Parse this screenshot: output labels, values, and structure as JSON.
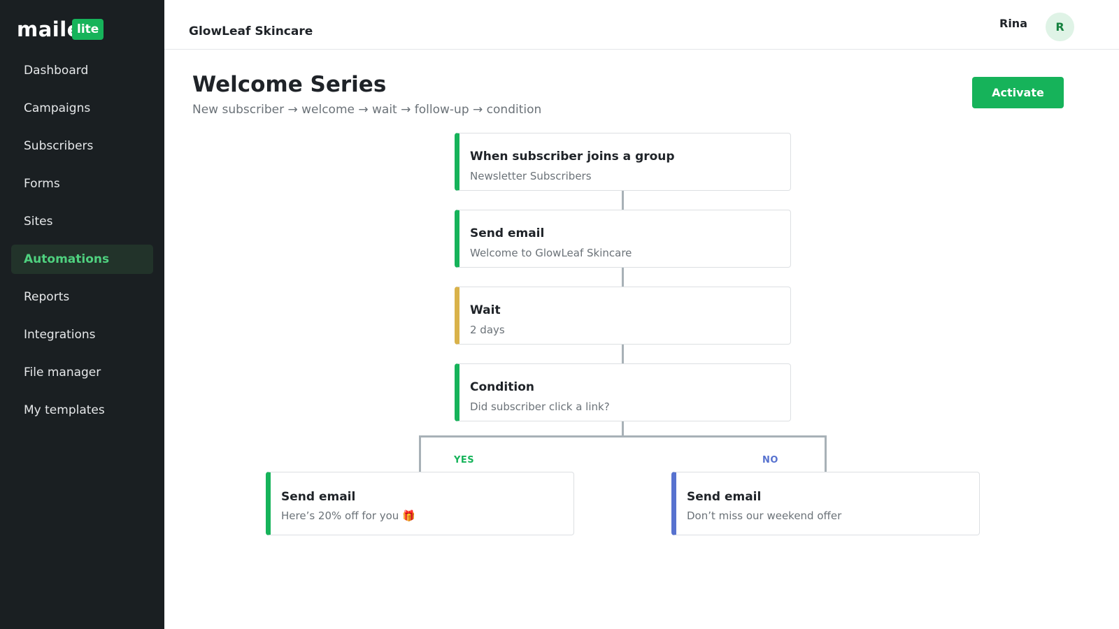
{
  "sidebar": {
    "logo_word": "maile",
    "logo_badge": "lite",
    "items": [
      {
        "label": "Dashboard"
      },
      {
        "label": "Campaigns"
      },
      {
        "label": "Subscribers"
      },
      {
        "label": "Forms"
      },
      {
        "label": "Sites"
      },
      {
        "label": "Automations",
        "active": true
      },
      {
        "label": "Reports"
      },
      {
        "label": "Integrations"
      },
      {
        "label": "File manager"
      },
      {
        "label": "My templates"
      }
    ]
  },
  "header": {
    "brand": "GlowLeaf Skincare",
    "user_name": "Rina",
    "avatar_initial": "R"
  },
  "page": {
    "title": "Welcome Series",
    "subtitle": "New subscriber → welcome → wait → follow-up → condition",
    "activate_label": "Activate"
  },
  "flow": {
    "steps": [
      {
        "title": "When subscriber joins a group",
        "desc": "Newsletter Subscribers",
        "kind": "trigger"
      },
      {
        "title": "Send email",
        "desc": "Welcome to GlowLeaf Skincare",
        "kind": "email"
      },
      {
        "title": "Wait",
        "desc": "2 days",
        "kind": "wait"
      },
      {
        "title": "Condition",
        "desc": "Did subscriber click a link?",
        "kind": "condition"
      }
    ],
    "branches": {
      "yes": {
        "label": "YES",
        "title": "Send email",
        "desc": "Here’s 20% off for you 🎁"
      },
      "no": {
        "label": "NO",
        "title": "Send email",
        "desc": "Don’t miss our weekend offer"
      }
    }
  },
  "colors": {
    "accent": "#16b35a",
    "wait": "#d9b24a",
    "no_branch": "#5772cf",
    "sidebar_bg": "#1a1f22"
  }
}
